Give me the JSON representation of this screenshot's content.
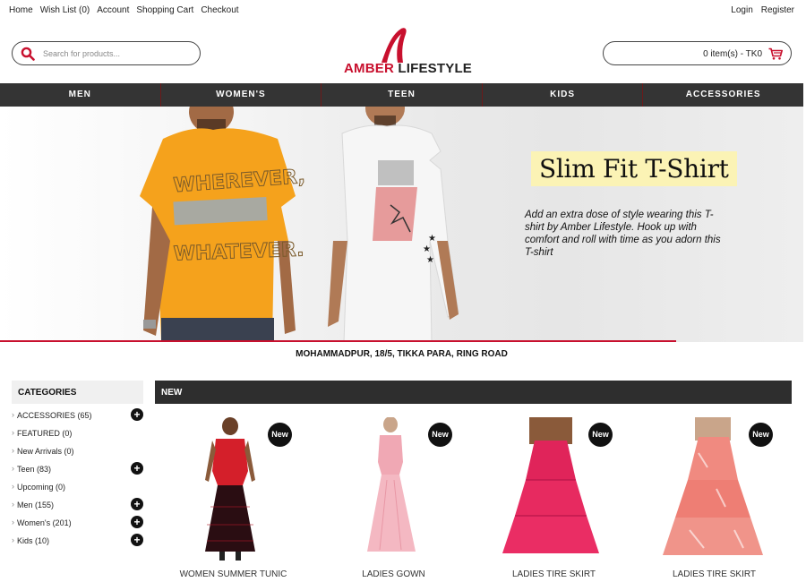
{
  "topbar": {
    "left_links": [
      "Home",
      "Wish List (0)",
      "Account",
      "Shopping Cart",
      "Checkout"
    ],
    "right_links": [
      "Login",
      "Register"
    ]
  },
  "search": {
    "placeholder": "Search for products..."
  },
  "logo": {
    "word1": "AMBER",
    "word2": "LIFESTYLE"
  },
  "cart": {
    "summary": "0 item(s) - TK0"
  },
  "nav": {
    "items": [
      "MEN",
      "WOMEN'S",
      "TEEN",
      "KIDS",
      "ACCESSORIES"
    ]
  },
  "banner": {
    "title": "Slim Fit T-Shirt",
    "description": "Add an extra dose of style wearing this T-shirt by Amber Lifestyle. Hook up with comfort and roll with time as you adorn this T-shirt",
    "shirt1_print": [
      "WHEREVER,",
      "WHATEVER."
    ]
  },
  "address": "MOHAMMADPUR, 18/5, TIKKA PARA, RING ROAD",
  "categories": {
    "heading": "CATEGORIES",
    "items": [
      {
        "label": "ACCESSORIES (65)",
        "expandable": true
      },
      {
        "label": "FEATURED (0)",
        "expandable": false
      },
      {
        "label": "New Arrivals (0)",
        "expandable": false
      },
      {
        "label": "Teen (83)",
        "expandable": true
      },
      {
        "label": "Upcoming (0)",
        "expandable": false
      },
      {
        "label": "Men (155)",
        "expandable": true
      },
      {
        "label": "Women's (201)",
        "expandable": true
      },
      {
        "label": "Kids (10)",
        "expandable": true
      }
    ]
  },
  "new_section": {
    "heading": "NEW",
    "badge": "New",
    "products": [
      {
        "name": "WOMEN SUMMER TUNIC"
      },
      {
        "name": "LADIES GOWN"
      },
      {
        "name": "LADIES TIRE SKIRT"
      },
      {
        "name": "LADIES TIRE SKIRT"
      }
    ]
  },
  "colors": {
    "brand_red": "#c8102e",
    "nav_bg": "#343434",
    "title_highlight": "#fbf3b5"
  }
}
